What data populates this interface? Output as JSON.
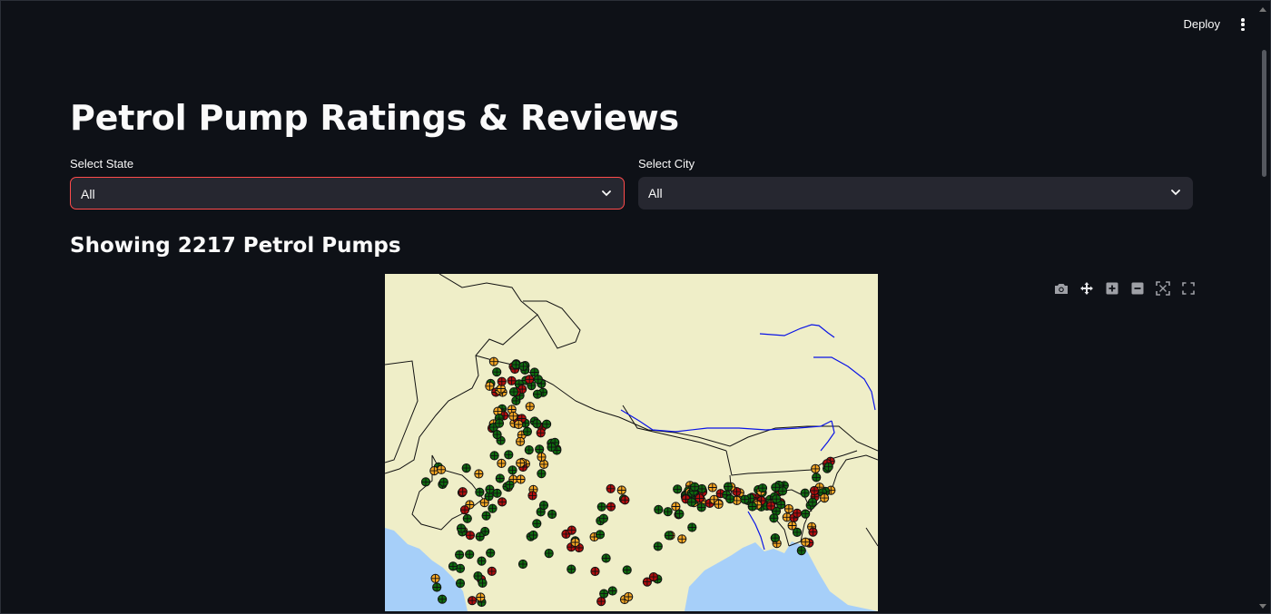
{
  "header": {
    "deploy_label": "Deploy",
    "menu_icon": "kebab-menu-icon"
  },
  "page": {
    "title": "Petrol Pump Ratings & Reviews",
    "subtitle": "Showing 2217 Petrol Pumps"
  },
  "filters": {
    "state": {
      "label": "Select State",
      "value": "All"
    },
    "city": {
      "label": "Select City",
      "value": "All"
    }
  },
  "modebar": [
    "camera-icon",
    "pan-icon",
    "zoom-in-icon",
    "zoom-out-icon",
    "autoscale-icon",
    "reset-axes-icon"
  ],
  "colors": {
    "background": "#0e1117",
    "select_bg": "#262730",
    "focus_border": "#ff4b4b",
    "land": "#efeec8",
    "water": "#a6cff9",
    "river": "#0a14e6",
    "rating_high": "#0e6a0e",
    "rating_mid": "#f5a623",
    "rating_low": "#b00d0d"
  }
}
